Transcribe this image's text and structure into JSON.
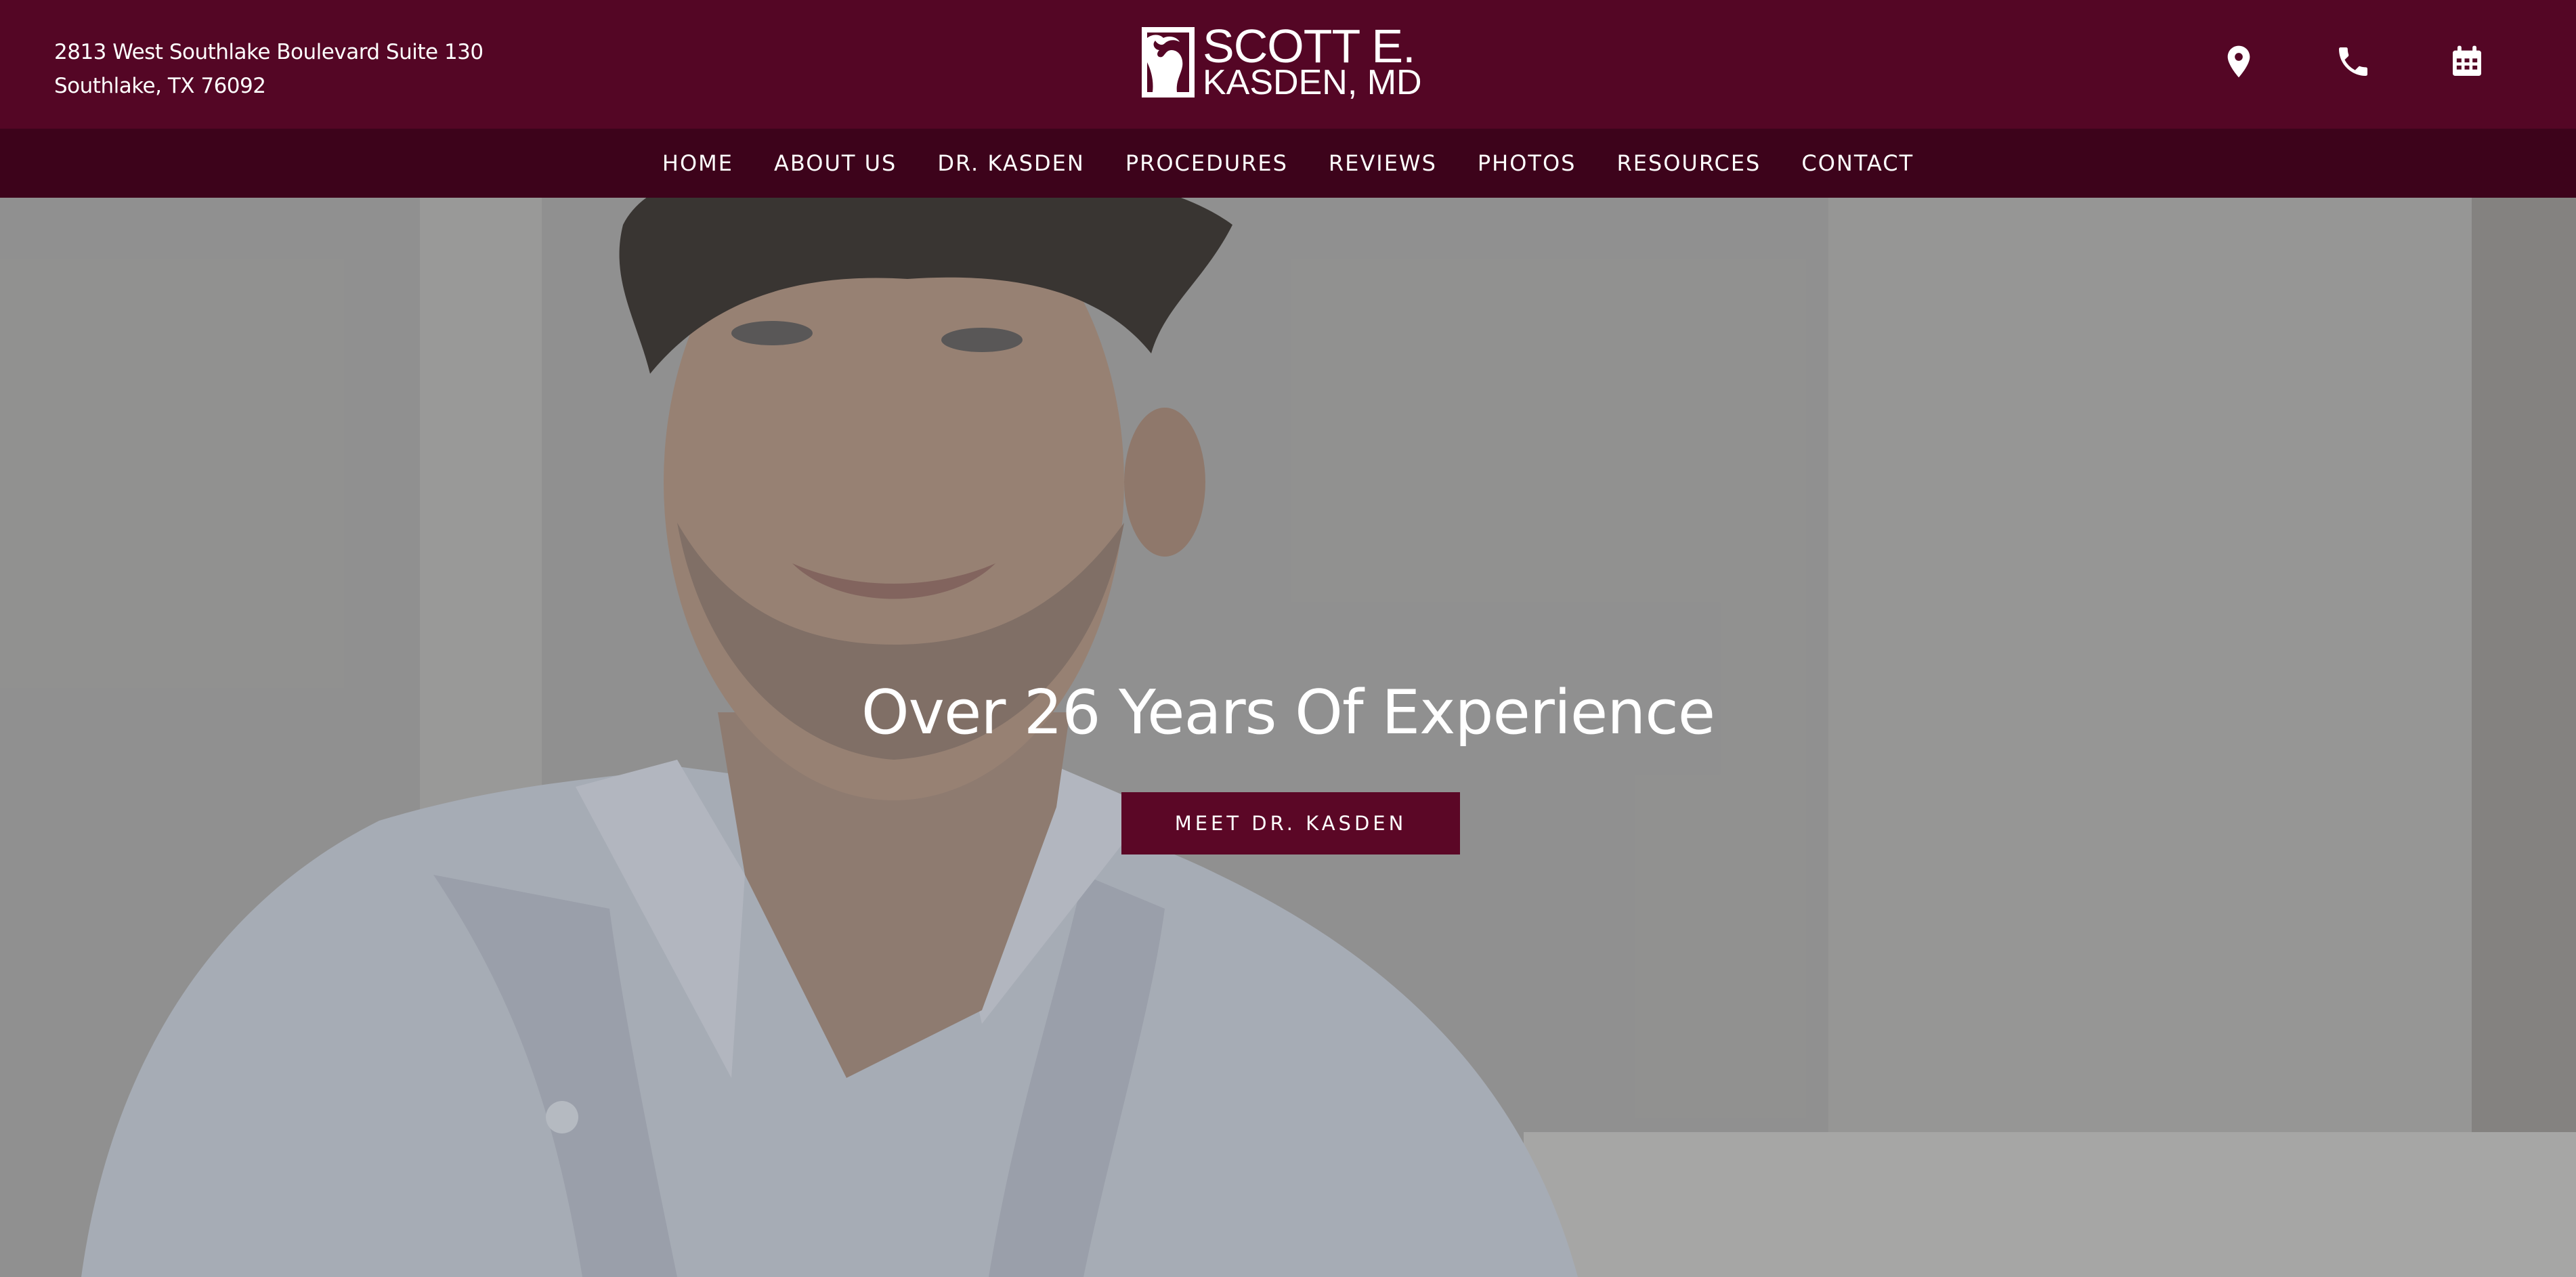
{
  "header": {
    "address_line1": "2813 West Southlake Boulevard Suite 130",
    "address_line2": "Southlake, TX 76092",
    "logo_line1": "SCOTT E.",
    "logo_line2": "KASDEN, MD",
    "icons": [
      "location-pin-icon",
      "phone-icon",
      "calendar-icon"
    ]
  },
  "nav": {
    "items": [
      {
        "label": "HOME"
      },
      {
        "label": "ABOUT US"
      },
      {
        "label": "DR. KASDEN"
      },
      {
        "label": "PROCEDURES"
      },
      {
        "label": "REVIEWS"
      },
      {
        "label": "PHOTOS"
      },
      {
        "label": "RESOURCES"
      },
      {
        "label": "CONTACT"
      }
    ]
  },
  "hero": {
    "title": "Over 26 Years Of Experience",
    "button_label": "MEET DR. KASDEN"
  },
  "colors": {
    "header_bg": "#540625",
    "nav_bg": "#3d031b",
    "button_bg": "#5b0726",
    "text": "#ffffff"
  }
}
